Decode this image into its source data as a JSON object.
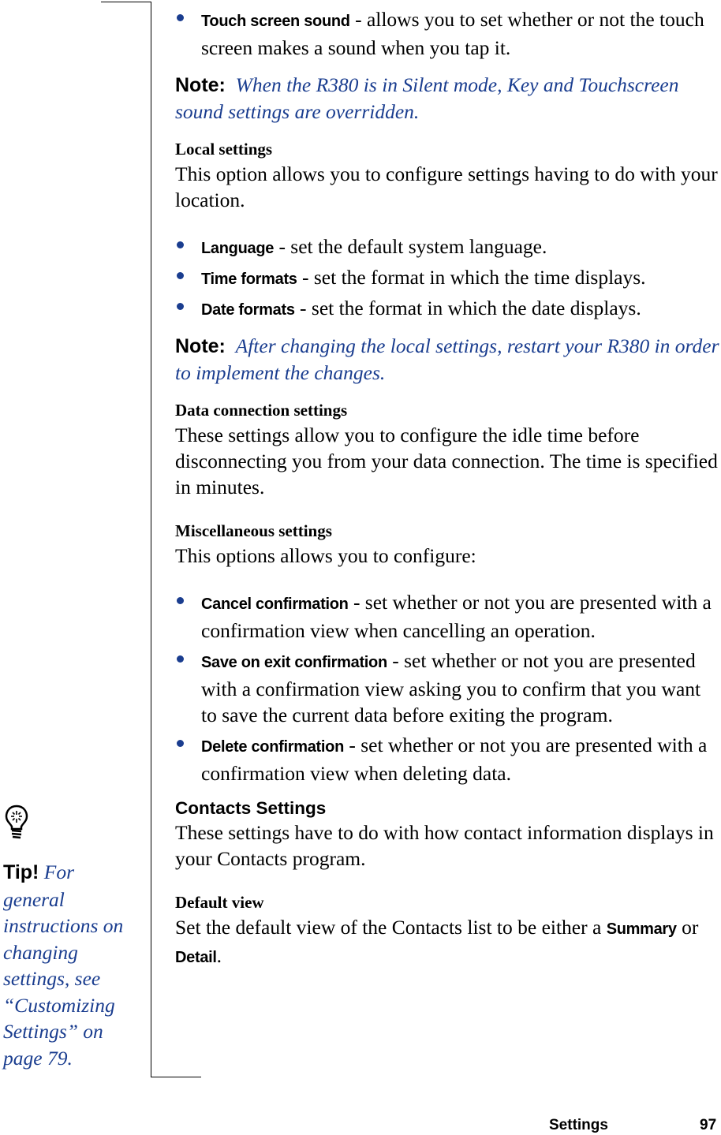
{
  "touch_screen": {
    "term": "Touch screen sound",
    "desc": " - allows you to set whether or not the touch screen makes a sound when you tap it."
  },
  "note1": {
    "label": "Note:",
    "text": "When the R380 is in Silent mode, Key and Touchscreen sound settings are overridden."
  },
  "local": {
    "heading": "Local settings",
    "intro": "This option allows you to configure settings having to do with your location.",
    "items": [
      {
        "term": "Language",
        "desc": " - set the default system language."
      },
      {
        "term": "Time formats",
        "desc": " - set the format in which the time displays."
      },
      {
        "term": "Date formats",
        "desc": " - set the format in which the date displays."
      }
    ]
  },
  "note2": {
    "label": "Note:",
    "text": "After changing the local settings, restart your R380 in order to implement the changes."
  },
  "data_conn": {
    "heading": "Data connection settings",
    "text": "These settings allow you to configure the idle time before disconnecting you from your data connection. The time is specified in minutes."
  },
  "misc": {
    "heading": "Miscellaneous settings",
    "intro": "This options allows you to configure:",
    "items": [
      {
        "term": "Cancel confirmation",
        "desc": " - set whether or not you are presented with a confirmation view when cancelling an operation."
      },
      {
        "term": "Save on exit confirmation",
        "desc": " - set whether or not you are presented with a confirmation view asking you to confirm that you want to save the current data before exiting the program."
      },
      {
        "term": "Delete confirmation",
        "desc": " - set whether or not you are presented with a confirmation view when deleting data."
      }
    ]
  },
  "contacts": {
    "heading": "Contacts Settings",
    "text": "These settings have to do with how contact information displays in your Contacts program."
  },
  "default_view": {
    "heading": "Default view",
    "text_before": "Set the default view of the Contacts list to be either a ",
    "opt1": "Summary",
    "or": " or ",
    "opt2": "Detail",
    "end": "."
  },
  "tip": {
    "icon": "lightbulb-icon",
    "label": "Tip!",
    "text": "For general instructions on changing settings, see “Customizing Settings” on page 79."
  },
  "footer": {
    "section": "Settings",
    "page": "97"
  },
  "colors": {
    "accent_blue": "#1a3d8f",
    "text": "#000000"
  }
}
